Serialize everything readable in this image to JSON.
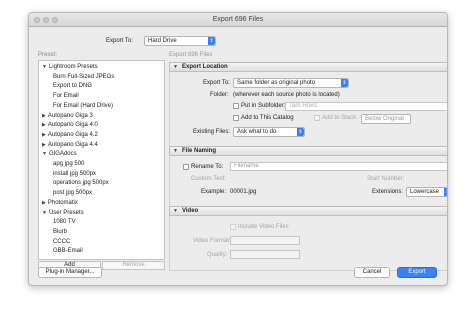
{
  "window": {
    "title": "Export 696 Files"
  },
  "top": {
    "export_to_label": "Export To:",
    "export_to_value": "Hard Drive"
  },
  "presets": {
    "heading": "Preset:",
    "items": [
      {
        "label": "Lightroom Presets",
        "group": true
      },
      {
        "label": "Burn Full-Sized JPEGs",
        "group": false
      },
      {
        "label": "Export to DNG",
        "group": false
      },
      {
        "label": "For Email",
        "group": false
      },
      {
        "label": "For Email (Hard Drive)",
        "group": false
      },
      {
        "label": "Autopano Giga 3",
        "group": true
      },
      {
        "label": "Autopano Giga 4.0",
        "group": true
      },
      {
        "label": "Autopano Giga 4.2",
        "group": true
      },
      {
        "label": "Autopano Giga 4.4",
        "group": true
      },
      {
        "label": "GIGAdocs",
        "group": true
      },
      {
        "label": "apg jpg 500",
        "group": false
      },
      {
        "label": "install jpg 500px",
        "group": false
      },
      {
        "label": "operations jpg 500px",
        "group": false
      },
      {
        "label": "post jpg 500px",
        "group": false
      },
      {
        "label": "Photomatix",
        "group": true
      },
      {
        "label": "User Presets",
        "group": true
      },
      {
        "label": "1080 TV",
        "group": false
      },
      {
        "label": "Blurb",
        "group": false
      },
      {
        "label": "CCCC",
        "group": false
      },
      {
        "label": "GBB-Email",
        "group": false
      }
    ],
    "add_label": "Add",
    "remove_label": "Remove"
  },
  "right_heading": "Export 696 Files",
  "export_location": {
    "title": "Export Location",
    "export_to_label": "Export To:",
    "export_to_value": "Same folder as original photo",
    "folder_label": "Folder:",
    "folder_value": "(wherever each source photo is located)",
    "subfolder_label": "Put in Subfolder:",
    "subfolder_value": "Tarn Hows",
    "add_catalog_label": "Add to This Catalog",
    "add_stack_label": "Add to Stack:",
    "stack_position": "Below Original",
    "existing_label": "Existing Files:",
    "existing_value": "Ask what to do"
  },
  "file_naming": {
    "title": "File Naming",
    "rename_label": "Rename To:",
    "rename_value": "Filename",
    "custom_text_label": "Custom Text:",
    "start_number_label": "Start Number:",
    "example_label": "Example:",
    "example_value": "00001.jpg",
    "extensions_label": "Extensions:",
    "extensions_value": "Lowercase"
  },
  "video": {
    "title": "Video",
    "include_label": "Include Video Files",
    "format_label": "Video Format:",
    "quality_label": "Quality:"
  },
  "buttons": {
    "plugin_manager": "Plug-in Manager...",
    "cancel": "Cancel",
    "export": "Export"
  },
  "colors": {
    "accent": "#3b82f6",
    "window_bg": "#ececec"
  }
}
